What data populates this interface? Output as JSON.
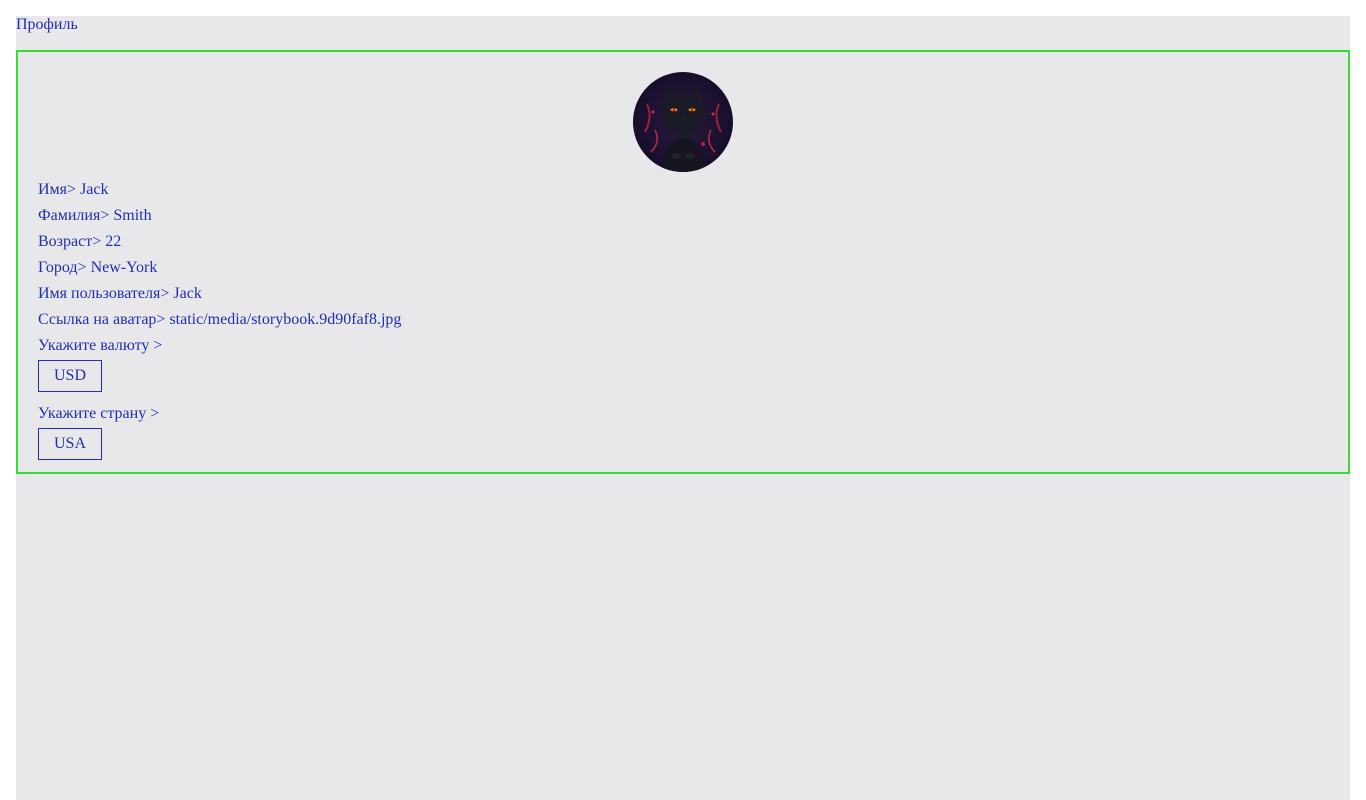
{
  "page": {
    "title": "Профиль"
  },
  "profile": {
    "avatar_icon": "black-cat-avatar",
    "fields": [
      {
        "label": "Имя",
        "value": "Jack"
      },
      {
        "label": "Фамилия",
        "value": "Smith"
      },
      {
        "label": "Возраст",
        "value": "22"
      },
      {
        "label": "Город",
        "value": "New-York"
      },
      {
        "label": "Имя пользователя",
        "value": "Jack"
      },
      {
        "label": "Ссылка на аватар",
        "value": "static/media/storybook.9d90faf8.jpg"
      }
    ],
    "separator": ">",
    "currency": {
      "prompt": "Укажите валюту >",
      "selected": "USD"
    },
    "country": {
      "prompt": "Укажите страну >",
      "selected": "USA"
    }
  },
  "colors": {
    "text": "#1f2fb0",
    "card_border": "#33e033",
    "page_bg": "#e8e8ea"
  }
}
